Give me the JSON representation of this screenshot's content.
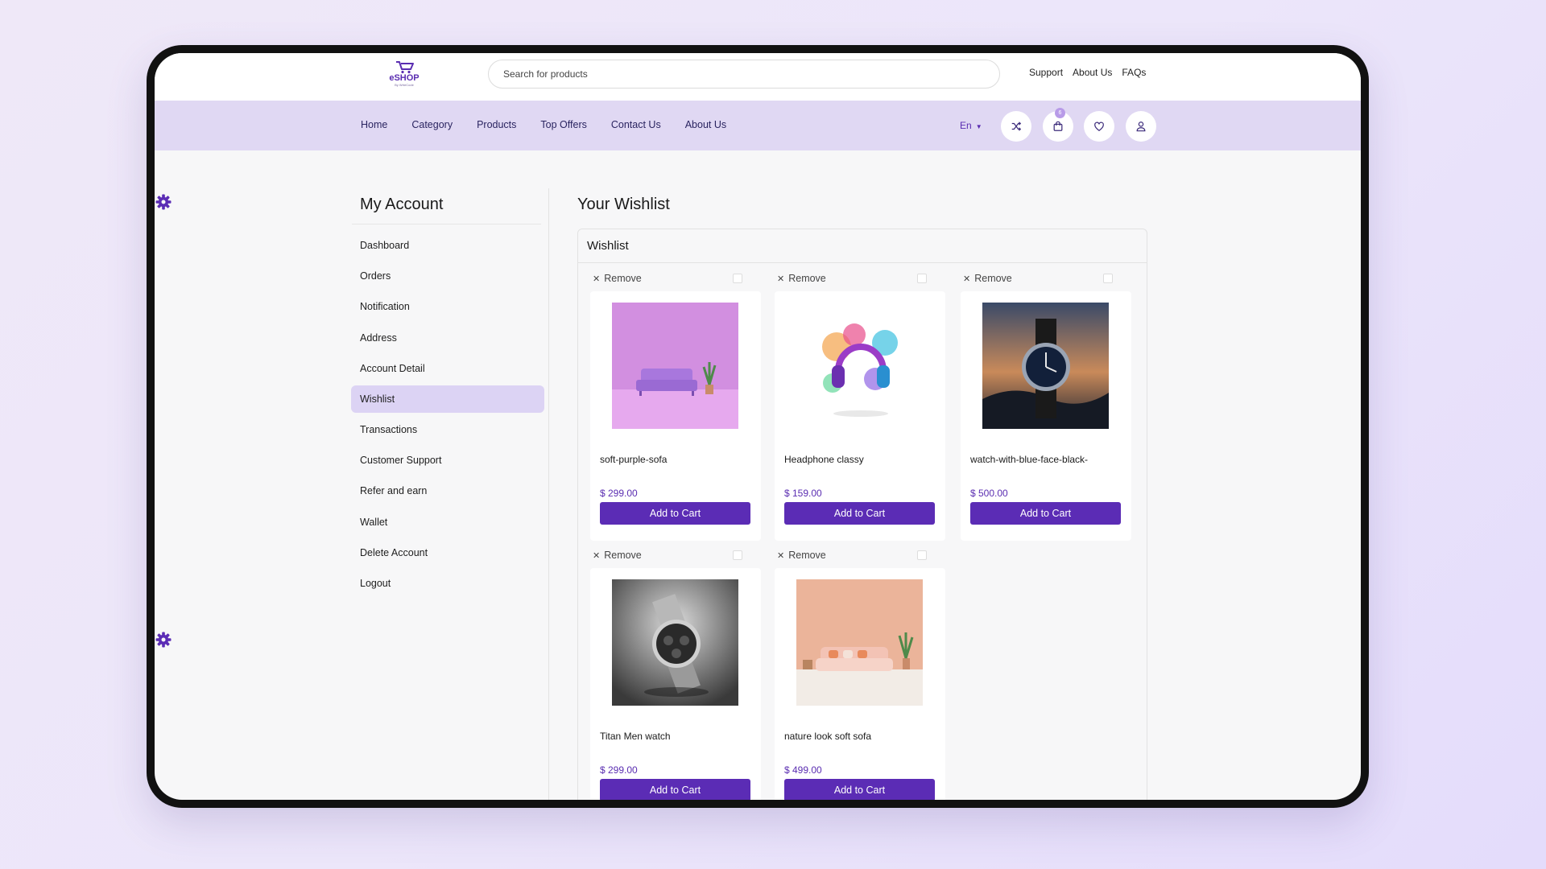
{
  "logo": {
    "text": "eSHOP",
    "tagline": "By WrteCode"
  },
  "search": {
    "placeholder": "Search for products"
  },
  "top_links": [
    "Support",
    "About Us",
    "FAQs"
  ],
  "nav": {
    "links": [
      "Home",
      "Category",
      "Products",
      "Top Offers",
      "Contact Us",
      "About Us"
    ],
    "language": "En",
    "cart_count": "6"
  },
  "sidebar": {
    "title": "My Account",
    "items": [
      "Dashboard",
      "Orders",
      "Notification",
      "Address",
      "Account Detail",
      "Wishlist",
      "Transactions",
      "Customer Support",
      "Refer and earn",
      "Wallet",
      "Delete Account",
      "Logout"
    ],
    "active": "Wishlist"
  },
  "main": {
    "title": "Your Wishlist",
    "panel_title": "Wishlist",
    "remove_label": "Remove",
    "add_to_cart_label": "Add to Cart",
    "products": [
      {
        "name": "soft-purple-sofa",
        "price": "$ 299.00",
        "image": "purple-sofa"
      },
      {
        "name": "Headphone classy",
        "price": "$ 159.00",
        "image": "headphones"
      },
      {
        "name": "watch-with-blue-face-black-",
        "price": "$ 500.00",
        "image": "blue-watch"
      },
      {
        "name": "Titan Men watch",
        "price": "$ 299.00",
        "image": "silver-watch"
      },
      {
        "name": "nature look soft sofa",
        "price": "$ 499.00",
        "image": "peach-sofa"
      }
    ]
  },
  "colors": {
    "accent": "#5b2cb5",
    "nav_bg": "#e0d8f3",
    "active_item": "#dcd3f4"
  }
}
